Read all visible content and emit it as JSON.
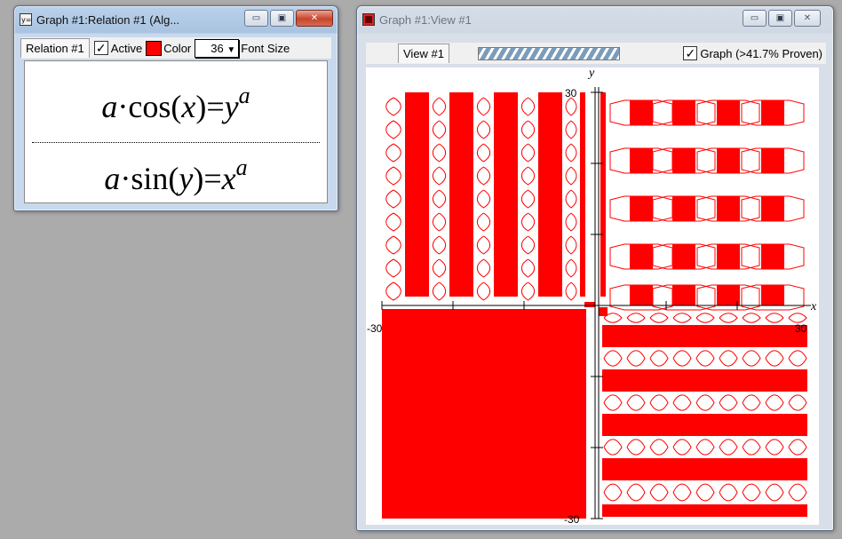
{
  "colors": {
    "plot_red": "#ff0000",
    "axis": "#000000"
  },
  "relation_window": {
    "title": "Graph #1:Relation #1 (Alg...",
    "tab_label": "Relation #1",
    "active_label": "Active",
    "active_checked": true,
    "color_label": "Color",
    "font_size_value": "36",
    "font_size_label": "Font Size",
    "eq1": {
      "coef": "a",
      "dot": "·",
      "func": "cos(",
      "arg": "x",
      "close": ")=",
      "rhs_base": "y",
      "rhs_exp": "a"
    },
    "eq2": {
      "coef": "a",
      "dot": "·",
      "func": "sin(",
      "arg": "y",
      "close": ")=",
      "rhs_base": "x",
      "rhs_exp": "a"
    }
  },
  "view_window": {
    "title": "Graph #1:View #1",
    "tab_label": "View #1",
    "graph_label": "Graph (>41.7% Proven)",
    "graph_checked": true,
    "x_axis_label": "x",
    "y_axis_label": "y",
    "x_min_label": "-30",
    "x_max_label": "30",
    "y_max_label": "30",
    "y_min_label": "-30"
  },
  "caption_icons": {
    "minimize": "minimize-icon",
    "maximize": "maximize-icon",
    "close": "close-icon"
  }
}
